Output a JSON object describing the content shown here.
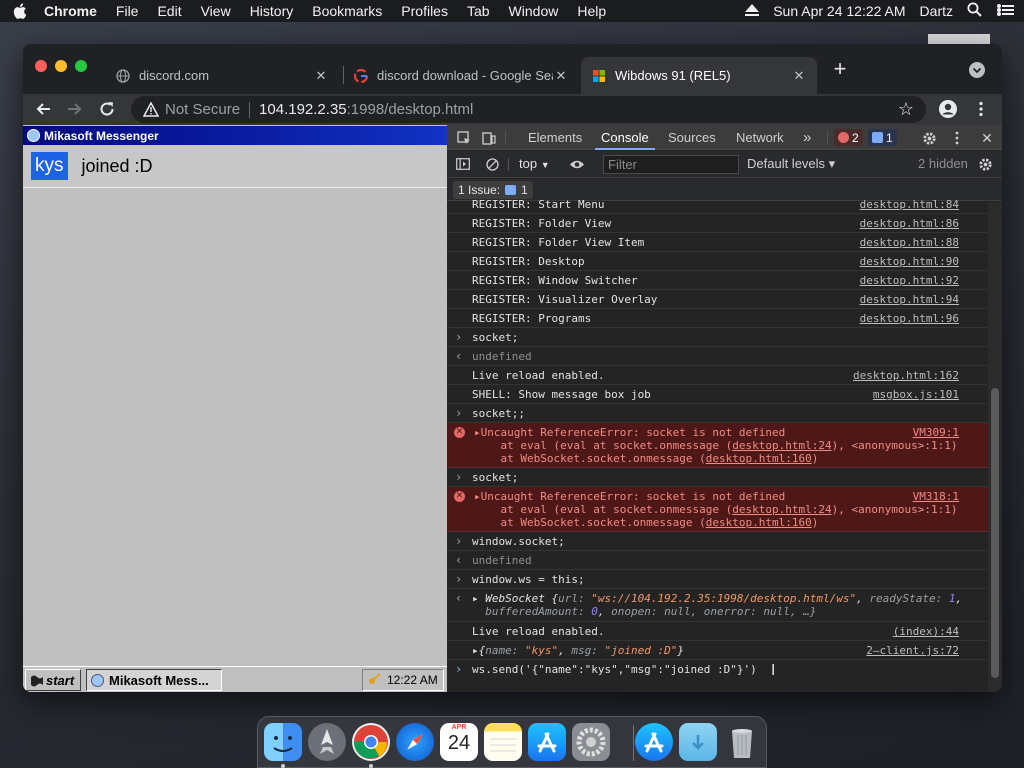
{
  "menubar": {
    "app": "Chrome",
    "items": [
      "File",
      "Edit",
      "View",
      "History",
      "Bookmarks",
      "Profiles",
      "Tab",
      "Window",
      "Help"
    ],
    "datetime": "Sun Apr 24  12:22 AM",
    "user": "Dartz"
  },
  "tabs": [
    {
      "title": "discord.com",
      "favicon": "globe-icon"
    },
    {
      "title": "discord download - Google Sea",
      "favicon": "google-icon"
    },
    {
      "title": "Wibdows 91 (REL5)",
      "favicon": "windows-icon"
    }
  ],
  "omnibox": {
    "security": "Not Secure",
    "host": "104.192.2.35",
    "path": ":1998/desktop.html"
  },
  "messenger": {
    "title": "Mikasoft Messenger",
    "messages": [
      {
        "user": "kys",
        "text": "joined :D"
      }
    ]
  },
  "taskbar": {
    "start": "start",
    "window": "Mikasoft Mess...",
    "clock": "12:22 AM"
  },
  "devtools": {
    "tabs": [
      "Elements",
      "Console",
      "Sources",
      "Network"
    ],
    "errors_count": "2",
    "messages_count": "1",
    "context": "top",
    "filter_placeholder": "Filter",
    "levels": "Default levels ▾",
    "hidden": "2 hidden",
    "issues_label": "1 Issue:",
    "issues_count": "1",
    "lines": [
      {
        "text": "REGISTER: Start Menu",
        "src": "desktop.html:84"
      },
      {
        "text": "REGISTER: Folder View",
        "src": "desktop.html:86"
      },
      {
        "text": "REGISTER: Folder View Item",
        "src": "desktop.html:88"
      },
      {
        "text": "REGISTER: Desktop",
        "src": "desktop.html:90"
      },
      {
        "text": "REGISTER: Window Switcher",
        "src": "desktop.html:92"
      },
      {
        "text": "REGISTER: Visualizer Overlay",
        "src": "desktop.html:94"
      },
      {
        "text": "REGISTER: Programs",
        "src": "desktop.html:96"
      }
    ],
    "in_socket1": "socket;",
    "out_undef1": "undefined",
    "live_reload1": "Live reload enabled.",
    "live_reload1_src": "desktop.html:162",
    "shell_msg": "SHELL: Show message box job",
    "shell_src": "msgbox.js:101",
    "in_socket2": "socket;;",
    "err1": {
      "head": "Uncaught ReferenceError: socket is not defined",
      "src": "VM309:1",
      "l2a": "    at eval (eval at socket.onmessage (",
      "l2link": "desktop.html:24",
      "l2b": "), <anonymous>:1:1)",
      "l3a": "    at WebSocket.socket.onmessage (",
      "l3link": "desktop.html:160",
      "l3b": ")"
    },
    "in_socket3": "socket;",
    "err2": {
      "head": "Uncaught ReferenceError: socket is not defined",
      "src": "VM318:1",
      "l2a": "    at eval (eval at socket.onmessage (",
      "l2link": "desktop.html:24",
      "l2b": "), <anonymous>:1:1)",
      "l3a": "    at WebSocket.socket.onmessage (",
      "l3link": "desktop.html:160",
      "l3b": ")"
    },
    "in_window_socket": "window.socket;",
    "out_undef2": "undefined",
    "in_ws_assign": "window.ws = this;",
    "ws_obj_name": "WebSocket",
    "ws_url": "\"ws://104.192.2.35:1998/desktop.html/ws\"",
    "ws_ready": "1",
    "ws_buffered": "0",
    "ws_rest": "onopen: null, onerror: null, …}",
    "live_reload2": "Live reload enabled.",
    "live_reload2_src": "(index):44",
    "obj_name": "\"kys\"",
    "obj_msg": "\"joined :D\"",
    "obj_src": "2–client.js:72",
    "prompt": "ws.send('{\"name\":\"kys\",\"msg\":\"joined :D\"}')"
  },
  "dock": {
    "apps": [
      "finder-icon",
      "launchpad-icon",
      "chrome-icon",
      "safari-icon",
      "calendar-icon",
      "notes-icon",
      "app-store-icon",
      "system-preferences-icon",
      "app-store-download-icon",
      "downloads-folder-icon",
      "trash-icon"
    ],
    "calendar_month": "APR",
    "calendar_day": "24"
  },
  "colors": {
    "devtools_accent": "#7cacf8",
    "error_bg": "#4e1818",
    "error_text": "#f28b82",
    "win_title": "#000a80",
    "kys_badge": "#1e62e6"
  }
}
